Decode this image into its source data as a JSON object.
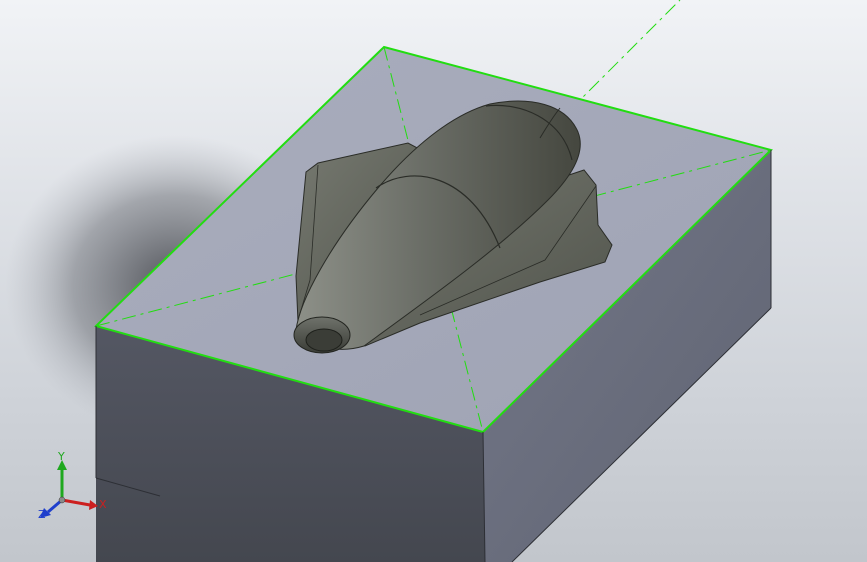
{
  "viewport": {
    "background_top": "#f1f3f6",
    "background_bottom": "#c2c6cc"
  },
  "model": {
    "block_top_color": "#a3a7b8",
    "block_left_color": "#4d505b",
    "block_right_color": "#6b6f7f",
    "edge_highlight_color": "#22dd11",
    "part_color": "#5d6059"
  },
  "triad": {
    "x_label": "X",
    "y_label": "Y",
    "z_label": "Z",
    "x_color": "#cc1f1f",
    "y_color": "#1fa81f",
    "z_color": "#1f3fcc"
  }
}
